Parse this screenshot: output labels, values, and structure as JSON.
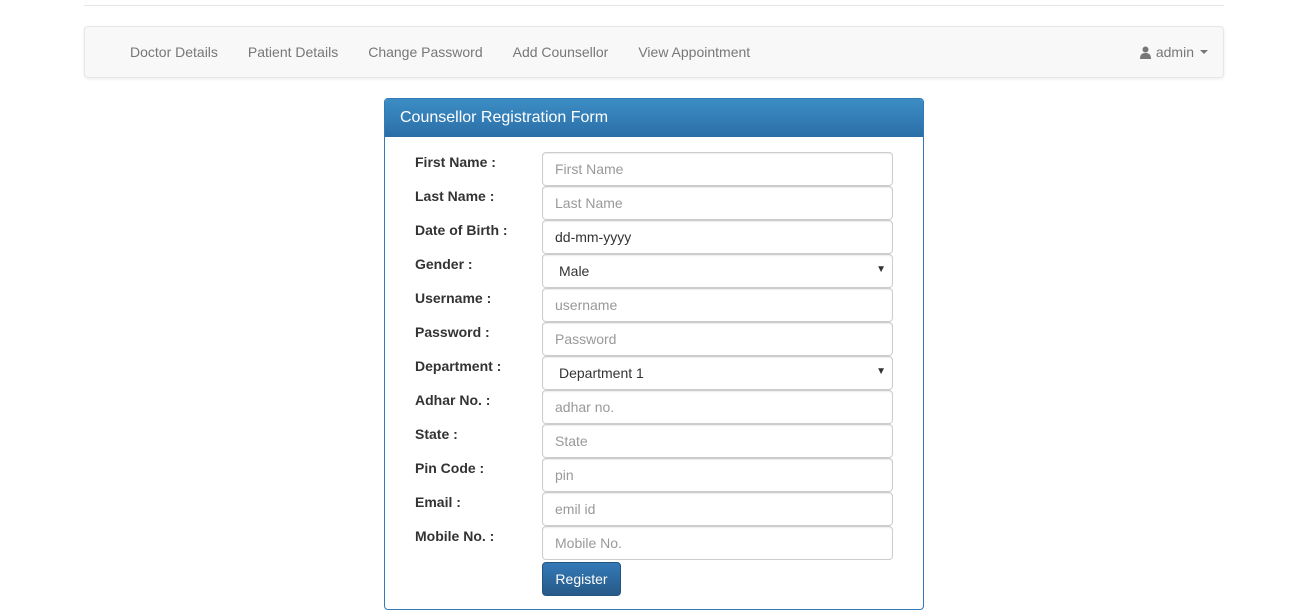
{
  "nav": {
    "links": [
      {
        "label": "Doctor Details"
      },
      {
        "label": "Patient Details"
      },
      {
        "label": "Change Password"
      },
      {
        "label": "Add Counsellor"
      },
      {
        "label": "View Appointment"
      }
    ],
    "user": {
      "label": "admin",
      "icon": "user-icon"
    }
  },
  "form": {
    "title": "Counsellor Registration Form",
    "first_name": {
      "label": "First Name :",
      "placeholder": "First Name"
    },
    "last_name": {
      "label": "Last Name :",
      "placeholder": "Last Name"
    },
    "dob": {
      "label": "Date of Birth :",
      "value": "dd-mm-yyyy"
    },
    "gender": {
      "label": "Gender :",
      "selected": "Male"
    },
    "username": {
      "label": "Username :",
      "placeholder": "username"
    },
    "password": {
      "label": "Password :",
      "placeholder": "Password"
    },
    "department": {
      "label": "Department :",
      "selected": "Department 1"
    },
    "adhar": {
      "label": "Adhar No. :",
      "placeholder": "adhar no."
    },
    "state": {
      "label": "State :",
      "placeholder": "State"
    },
    "pin": {
      "label": "Pin Code :",
      "placeholder": "pin"
    },
    "email": {
      "label": "Email :",
      "placeholder": "emil id"
    },
    "mobile": {
      "label": "Mobile No. :",
      "placeholder": "Mobile No."
    },
    "submit_label": "Register"
  },
  "colors": {
    "primary": "#337ab7",
    "navbar_bg": "#f8f8f8",
    "nav_text": "#777777"
  }
}
